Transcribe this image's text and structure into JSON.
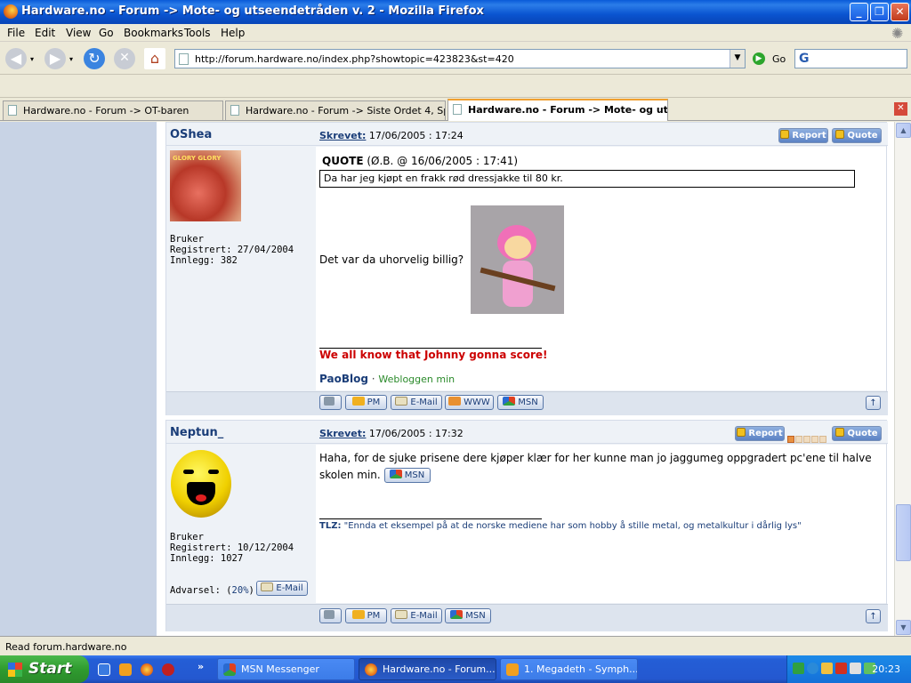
{
  "window": {
    "title": "Hardware.no - Forum -> Mote- og utseendetråden v. 2 - Mozilla Firefox"
  },
  "menu": [
    "File",
    "Edit",
    "View",
    "Go",
    "Bookmarks",
    "Tools",
    "Help"
  ],
  "nav": {
    "url": "http://forum.hardware.no/index.php?showtopic=423823&st=420",
    "go_label": "Go",
    "search_logo": "G"
  },
  "tabs": [
    {
      "label": "Hardware.no - Forum -> OT-baren"
    },
    {
      "label": "Hardware.no - Forum -> Siste Ordet 4, Spa..."
    },
    {
      "label": "Hardware.no - Forum -> Mote- og ut..."
    }
  ],
  "posts": [
    {
      "username": "OShea",
      "skrevet_label": "Skrevet:",
      "date": "17/06/2005 : 17:24",
      "report_label": "Report",
      "quote_label": "Quote",
      "avatar_text": "GLORY GLORY",
      "rank": "Bruker",
      "registered": "Registrert: 27/04/2004",
      "posts_count": "Innlegg: 382",
      "quote_header": "QUOTE",
      "quote_meta": "(Ø.B. @ 16/06/2005 : 17:41)",
      "quote_text": "Da har jeg kjøpt en frakk rød dressjakke til 80 kr.",
      "body_text": "Det var da uhorvelig billig?",
      "sig_red": "We all know that Johnny gonna score!",
      "sig_link": "PaoBlog",
      "sig_sep": "·",
      "sig_green": "Webloggen min",
      "footer_buttons": [
        "PM",
        "E-Mail",
        "WWW",
        "MSN"
      ]
    },
    {
      "username": "Neptun_",
      "skrevet_label": "Skrevet:",
      "date": "17/06/2005 : 17:32",
      "report_label": "Report",
      "quote_label": "Quote",
      "rank": "Bruker",
      "registered": "Registrert: 10/12/2004",
      "posts_count": "Innlegg: 1027",
      "warn_label": "Advarsel: (",
      "warn_value": "20%",
      "warn_close": ")",
      "email_label": "E-Mail",
      "body_text": "Haha, for de sjuke prisene dere kjøper klær for her kunne man jo jaggumeg oppgradert pc'ene til halve skolen min.",
      "msn_label": "MSN",
      "sig_bold": "TLZ:",
      "sig_text": "\"Ennda et eksempel på at de norske mediene har som hobby å stille metal, og metalkultur i dårlig lys\"",
      "footer_buttons": [
        "PM",
        "E-Mail",
        "MSN"
      ]
    }
  ],
  "status": "Read forum.hardware.no",
  "taskbar": {
    "start_label": "Start",
    "items": [
      {
        "label": "MSN Messenger"
      },
      {
        "label": "Hardware.no - Forum..."
      },
      {
        "label": "1. Megadeth - Symph..."
      }
    ],
    "clock": "20:23"
  },
  "colors": {
    "accent": "#1a3d78",
    "sig_red": "#cc0000",
    "sig_green": "#2a8a2a"
  }
}
